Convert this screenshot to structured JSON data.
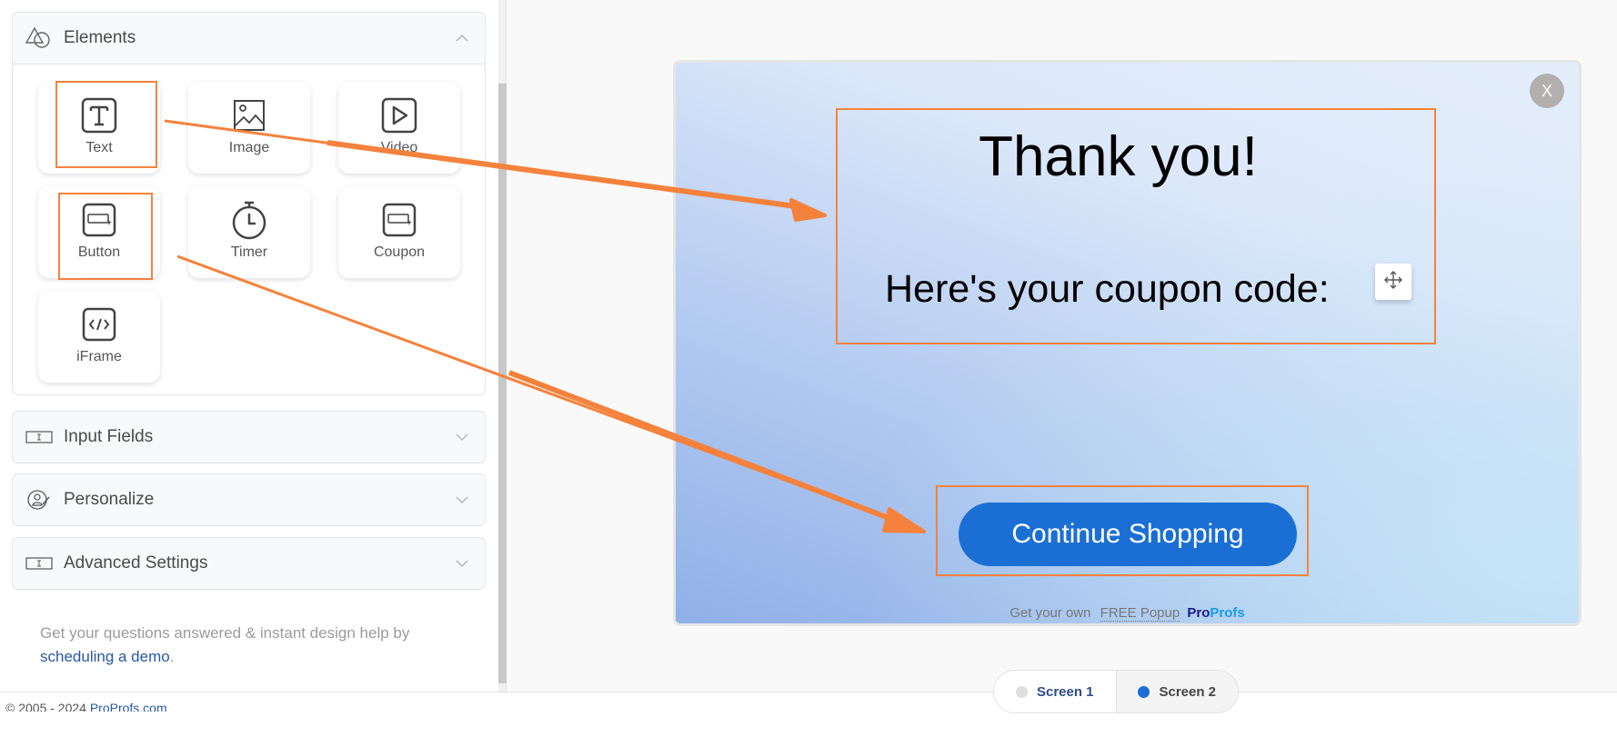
{
  "sidebar": {
    "panels": [
      {
        "label": "Elements",
        "icon": "shapes-icon",
        "expanded": true
      },
      {
        "label": "Input Fields",
        "icon": "input-field-icon",
        "expanded": false
      },
      {
        "label": "Personalize",
        "icon": "personalize-user-icon",
        "expanded": false
      },
      {
        "label": "Advanced Settings",
        "icon": "input-field-icon",
        "expanded": false
      }
    ],
    "elements": [
      {
        "label": "Text",
        "icon": "text-icon"
      },
      {
        "label": "Image",
        "icon": "image-icon"
      },
      {
        "label": "Video",
        "icon": "video-play-icon"
      },
      {
        "label": "Button",
        "icon": "button-icon"
      },
      {
        "label": "Timer",
        "icon": "stopwatch-icon"
      },
      {
        "label": "Coupon",
        "icon": "coupon-icon"
      },
      {
        "label": "iFrame",
        "icon": "code-icon"
      }
    ],
    "help_text": "Get your questions answered & instant design help by",
    "help_link": "scheduling a demo",
    "help_suffix": "."
  },
  "footer": {
    "copyright": "© 2005 - 2024",
    "site_link": "ProProfs.com"
  },
  "popup": {
    "close_label": "X",
    "title": "Thank you!",
    "subtitle": "Here's your coupon code:",
    "cta_label": "Continue Shopping",
    "branding_prefix": "Get your own",
    "branding_link": "FREE Popup",
    "brand_part1": "Pro",
    "brand_part2": "Profs"
  },
  "screens": [
    {
      "label": "Screen 1",
      "active": false,
      "dot_color": "#dedede"
    },
    {
      "label": "Screen 2",
      "active": true,
      "dot_color": "#1b6fd4"
    }
  ],
  "colors": {
    "accent_blue": "#1b6fd4",
    "annotation_orange": "#f5823c",
    "link_blue": "#2b57a6"
  }
}
